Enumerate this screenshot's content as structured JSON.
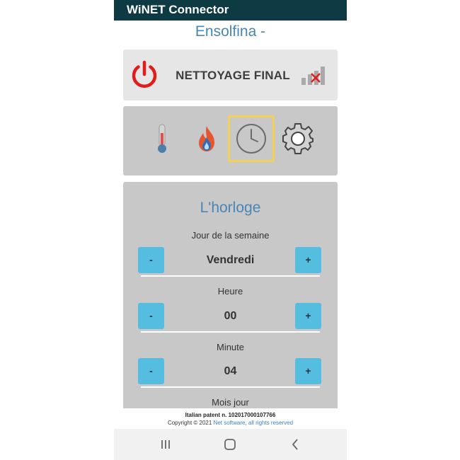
{
  "app": {
    "title": "WiNET Connector"
  },
  "device": {
    "name": "Ensolfina -"
  },
  "status": {
    "text": "NETTOYAGE FINAL",
    "power_color": "#e21b1b",
    "signal": "no-connection"
  },
  "tabs": [
    {
      "icon": "thermometer-icon",
      "active": false
    },
    {
      "icon": "flame-icon",
      "active": false
    },
    {
      "icon": "clock-icon",
      "active": true
    },
    {
      "icon": "gear-icon",
      "active": false
    }
  ],
  "clock": {
    "title": "L'horloge",
    "fields": [
      {
        "label": "Jour de la semaine",
        "value": "Vendredi",
        "minus": "-",
        "plus": "+"
      },
      {
        "label": "Heure",
        "value": "00",
        "minus": "-",
        "plus": "+"
      },
      {
        "label": "Minute",
        "value": "04",
        "minus": "-",
        "plus": "+"
      },
      {
        "label": "Mois jour"
      }
    ]
  },
  "footer": {
    "patent": "Italian patent n. 102017000107766",
    "copyright_prefix": "Copyright © 2021 ",
    "copyright_link": "Net software, all rights reserved"
  },
  "colors": {
    "appbar": "#0e3a44",
    "accent": "#4a86b4",
    "stepper": "#55bde0",
    "active_tab_border": "#f6cf55"
  },
  "navbar": [
    {
      "icon": "recent-apps-icon"
    },
    {
      "icon": "home-icon"
    },
    {
      "icon": "back-icon"
    }
  ]
}
